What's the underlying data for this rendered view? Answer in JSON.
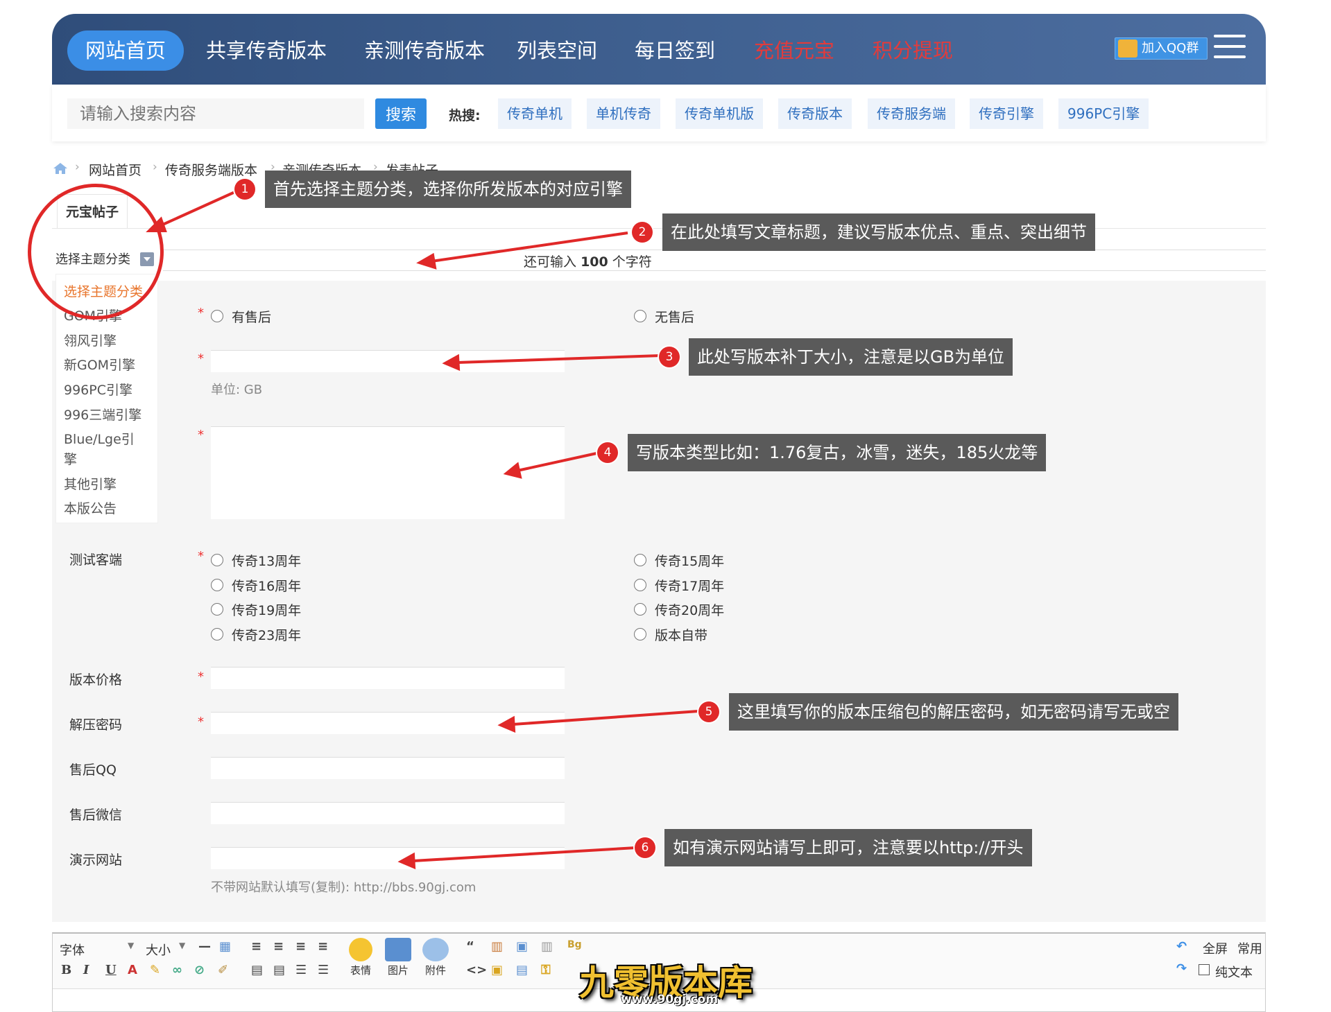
{
  "nav": {
    "items": [
      "网站首页",
      "共享传奇版本",
      "亲测传奇版本",
      "列表空间",
      "每日签到",
      "充值元宝",
      "积分提现"
    ],
    "qq_label": "加入QQ群"
  },
  "search": {
    "placeholder": "请输入搜索内容",
    "button": "搜索",
    "hot_label": "热搜:",
    "hot_tags": [
      "传奇单机",
      "单机传奇",
      "传奇单机版",
      "传奇版本",
      "传奇服务端",
      "传奇引擎",
      "996PC引擎"
    ]
  },
  "breadcrumb": [
    "网站首页",
    "传奇服务端版本",
    "亲测传奇版本",
    "发表帖子"
  ],
  "form": {
    "tab": "元宝帖子",
    "topic_select": "选择主题分类",
    "topic_options": [
      "选择主题分类",
      "GOM引擎",
      "翎风引擎",
      "新GOM引擎",
      "996PC引擎",
      "996三端引擎",
      "Blue/Lge引擎",
      "其他引擎",
      "本版公告"
    ],
    "counter_prefix": "还可输入",
    "counter_value": "100",
    "counter_suffix": "个字符",
    "aftersale": [
      "有售后",
      "无售后"
    ],
    "unit_hint": "单位: GB",
    "client_label": "测试客端",
    "client_options": [
      "传奇13周年",
      "传奇15周年",
      "传奇16周年",
      "传奇17周年",
      "传奇19周年",
      "传奇20周年",
      "传奇23周年",
      "版本自带"
    ],
    "price_label": "版本价格",
    "password_label": "解压密码",
    "qq_label": "售后QQ",
    "wechat_label": "售后微信",
    "demo_label": "演示网站",
    "demo_hint": "不带网站默认填写(复制): http://bbs.90gj.com"
  },
  "annotations": [
    {
      "num": "1",
      "text": "首先选择主题分类，选择你所发版本的对应引擎"
    },
    {
      "num": "2",
      "text": "在此处填写文章标题，建议写版本优点、重点、突出细节"
    },
    {
      "num": "3",
      "text": "此处写版本补丁大小，注意是以GB为单位"
    },
    {
      "num": "4",
      "text": "写版本类型比如：1.76复古，冰雪，迷失，185火龙等"
    },
    {
      "num": "5",
      "text": "这里填写你的版本压缩包的解压密码，如无密码请写无或空"
    },
    {
      "num": "6",
      "text": "如有演示网站请写上即可，注意要以http://开头"
    }
  ],
  "editor": {
    "font_label": "字体",
    "size_label": "大小",
    "emoji_label": "表情",
    "image_label": "图片",
    "attach_label": "附件",
    "fullscreen_label": "全屏",
    "common_label": "常用",
    "plaintext_label": "纯文本"
  },
  "watermark": {
    "title": "九零版本库",
    "url": "www.90gj.com"
  },
  "colors": {
    "nav_bg": "#3f6090",
    "accent": "#3b8ee6",
    "red": "#e02828",
    "annotation_bg": "#5a5a5a"
  }
}
